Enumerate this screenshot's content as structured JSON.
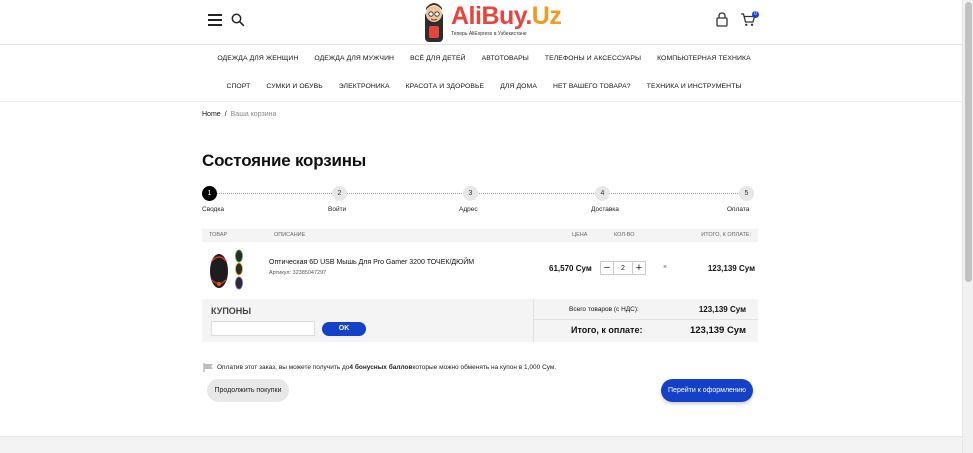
{
  "header": {
    "logo_main": "AliBuy.",
    "logo_uz": "Uz",
    "logo_tagline": "Теперь AliExpress в Узбекистане",
    "cart_count": "0"
  },
  "nav": {
    "row1": [
      "ОДЕЖДА ДЛЯ ЖЕНЩИН",
      "ОДЕЖДА ДЛЯ МУЖЧИН",
      "ВСЁ ДЛЯ ДЕТЕЙ",
      "АВТОТОВАРЫ",
      "ТЕЛЕФОНЫ И АКСЕССУАРЫ",
      "КОМПЬЮТЕРНАЯ ТЕХНИКА"
    ],
    "row2": [
      "СПОРТ",
      "СУМКИ И ОБУВЬ",
      "ЭЛЕКТРОНИКА",
      "КРАСОТА И ЗДОРОВЬЕ",
      "ДЛЯ ДОМА",
      "НЕТ ВАШЕГО ТОВАРА?",
      "ТЕХНИКА И ИНСТРУМЕНТЫ"
    ]
  },
  "breadcrumb": {
    "home": "Home",
    "separator": "/",
    "current": "Ваша корзина"
  },
  "page_title": "Состояние корзины",
  "steps": [
    {
      "num": "1",
      "label": "Сводка",
      "active": true
    },
    {
      "num": "2",
      "label": "Войти",
      "active": false
    },
    {
      "num": "3",
      "label": "Адрес",
      "active": false
    },
    {
      "num": "4",
      "label": "Доставка",
      "active": false
    },
    {
      "num": "5",
      "label": "Оплата",
      "active": false
    }
  ],
  "table": {
    "headers": {
      "product": "ТОВАР",
      "description": "ОПИСАНИЕ",
      "price": "ЦЕНА",
      "qty": "КОЛ-ВО",
      "total": "ИТОГО, К ОПЛАТЕ:"
    },
    "item": {
      "name": "Оптическая 6D USB Мышь Для Pro Gamer 3200 ТОЧЕК/ДЮЙМ",
      "sku": "Артикул: 32385047297",
      "price": "61,570 Сум",
      "qty": "2",
      "minus": "−",
      "plus": "+",
      "remove": "×",
      "total": "123,139 Сум"
    }
  },
  "coupons": {
    "title": "КУПОНЫ",
    "input_value": "",
    "button": "OK"
  },
  "totals": {
    "subtotal_label": "Всего товаров (с НДС):",
    "subtotal_value": "123,139 Сум",
    "grand_label": "Итого, к оплате:",
    "grand_value": "123,139 Сум"
  },
  "bonus": {
    "pre": "Оплатив этот заказ, вы можете получить до ",
    "bold": "4 бонусных баллов",
    "post": " которые можно обменять на купон в 1,000 Сум."
  },
  "buttons": {
    "continue": "Продолжить покупки",
    "checkout": "Перейти к оформлению"
  },
  "colors": {
    "accent": "#1541c9",
    "logo_red": "#e9443a",
    "logo_orange": "#f29a1d"
  }
}
